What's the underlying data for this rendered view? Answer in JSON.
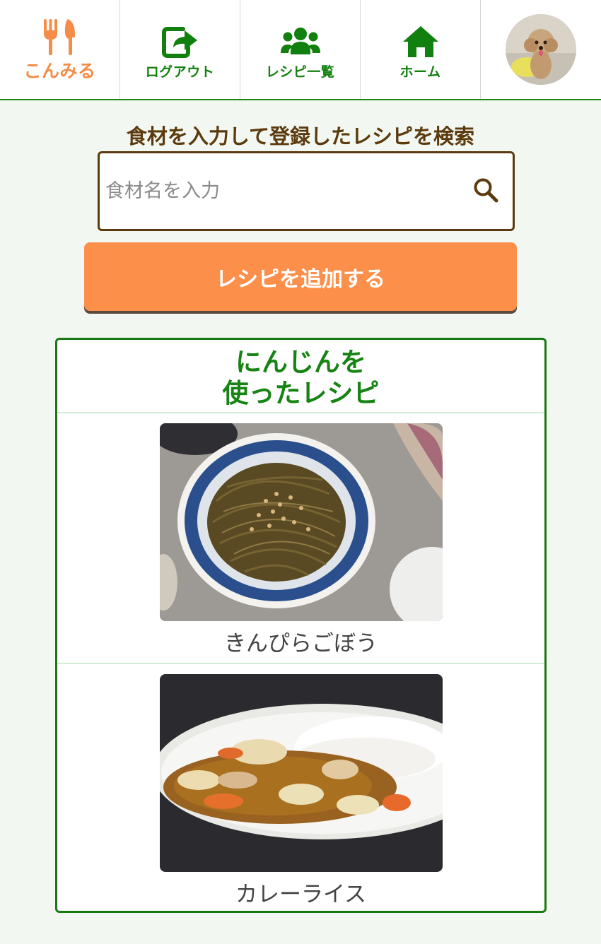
{
  "nav": {
    "items": [
      {
        "label": "こんみる",
        "icon": "fork-knife-icon"
      },
      {
        "label": "ログアウト",
        "icon": "logout-icon"
      },
      {
        "label": "レシピ一覧",
        "icon": "users-icon"
      },
      {
        "label": "ホーム",
        "icon": "home-icon"
      }
    ],
    "avatar_icon": "user-avatar"
  },
  "search": {
    "heading": "食材を入力して登録したレシピを検索",
    "placeholder": "食材名を入力",
    "value": "",
    "icon": "search-icon"
  },
  "add_button": {
    "label": "レシピを追加する"
  },
  "results": {
    "title_line1": "にんじんを",
    "title_line2": "使ったレシピ",
    "recipes": [
      {
        "name": "きんぴらごぼう"
      },
      {
        "name": "カレーライス"
      }
    ]
  },
  "colors": {
    "accent_orange": "#fc8f4a",
    "brand_green": "#178313",
    "brown": "#5b3a0e",
    "background": "#f2f7f2"
  }
}
